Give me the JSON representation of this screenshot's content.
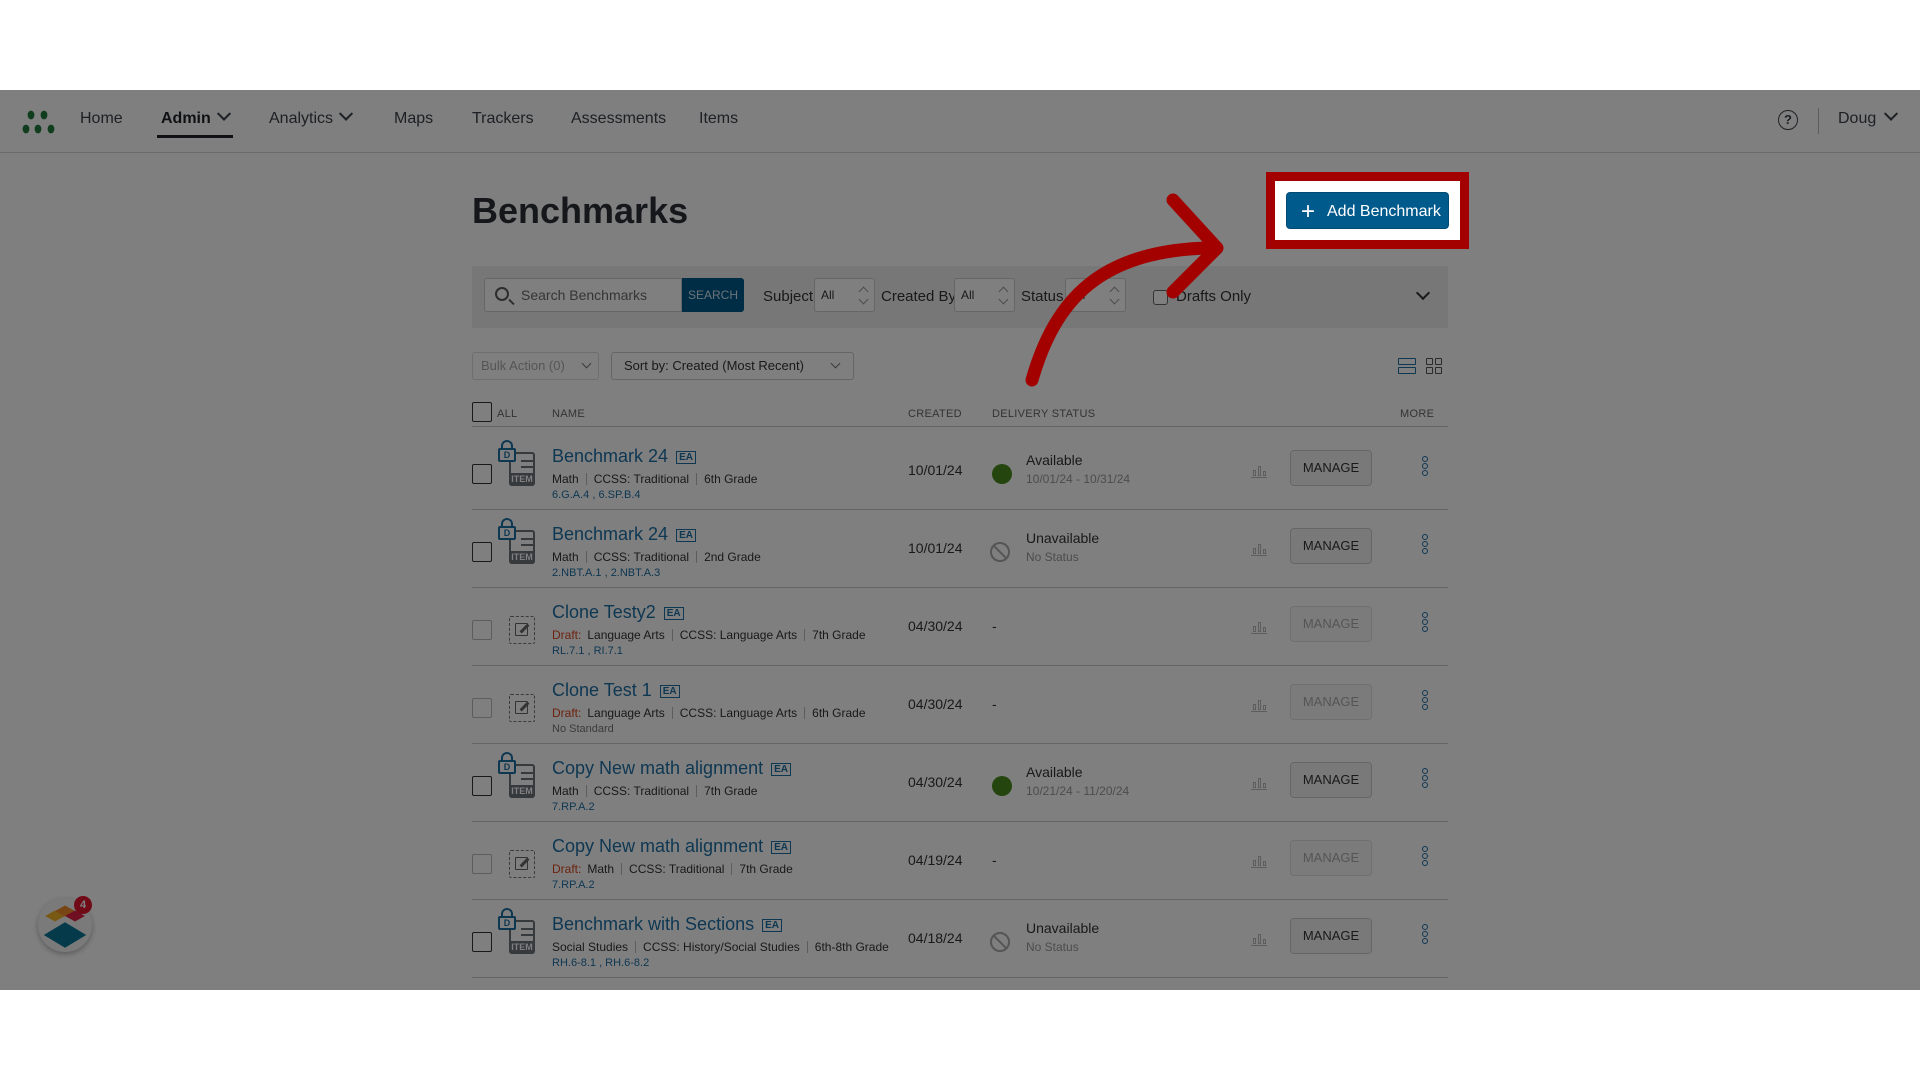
{
  "nav": {
    "items": [
      {
        "label": "Home",
        "active": false,
        "has_dropdown": false
      },
      {
        "label": "Admin",
        "active": true,
        "has_dropdown": true
      },
      {
        "label": "Analytics",
        "active": false,
        "has_dropdown": true
      },
      {
        "label": "Maps",
        "active": false,
        "has_dropdown": false
      },
      {
        "label": "Trackers",
        "active": false,
        "has_dropdown": false
      },
      {
        "label": "Assessments",
        "active": false,
        "has_dropdown": false
      },
      {
        "label": "Items",
        "active": false,
        "has_dropdown": false
      }
    ],
    "help_icon": "?",
    "user": "Doug"
  },
  "page": {
    "title": "Benchmarks",
    "add_button": "Add Benchmark",
    "add_icon": "+"
  },
  "filters": {
    "search_placeholder": "Search Benchmarks",
    "search_button": "SEARCH",
    "subject_label": "Subject",
    "subject_value": "All",
    "created_by_label": "Created By",
    "created_by_value": "All",
    "status_label": "Status",
    "status_value": "All",
    "drafts_only_label": "Drafts Only",
    "drafts_only_checked": false
  },
  "toolbar": {
    "bulk_action": "Bulk Action (0)",
    "sort_by": "Sort by: Created (Most Recent)"
  },
  "table": {
    "headers": {
      "all": "ALL",
      "name": "NAME",
      "created": "CREATED",
      "delivery_status": "DELIVERY STATUS",
      "more": "MORE"
    },
    "manage_label": "MANAGE",
    "ea_badge": "EA",
    "draft_label": "Draft:",
    "rows": [
      {
        "name": "Benchmark 24",
        "draft": false,
        "subject": "Math",
        "standard_set": "CCSS: Traditional",
        "grade": "6th Grade",
        "standards": "6.G.A.4 , 6.SP.B.4",
        "created": "10/01/24",
        "status": "Available",
        "status_detail": "10/01/24 - 10/31/24",
        "status_type": "available"
      },
      {
        "name": "Benchmark 24",
        "draft": false,
        "subject": "Math",
        "standard_set": "CCSS: Traditional",
        "grade": "2nd Grade",
        "standards": "2.NBT.A.1 , 2.NBT.A.3",
        "created": "10/01/24",
        "status": "Unavailable",
        "status_detail": "No Status",
        "status_type": "unavailable"
      },
      {
        "name": "Clone Testy2",
        "draft": true,
        "subject": "Language Arts",
        "standard_set": "CCSS: Language Arts",
        "grade": "7th Grade",
        "standards": "RL.7.1 , RI.7.1",
        "created": "04/30/24",
        "status": "-",
        "status_detail": "",
        "status_type": "none"
      },
      {
        "name": "Clone Test 1",
        "draft": true,
        "subject": "Language Arts",
        "standard_set": "CCSS: Language Arts",
        "grade": "6th Grade",
        "standards": "No Standard",
        "created": "04/30/24",
        "status": "-",
        "status_detail": "",
        "status_type": "none"
      },
      {
        "name": "Copy New math alignment",
        "draft": false,
        "subject": "Math",
        "standard_set": "CCSS: Traditional",
        "grade": "7th Grade",
        "standards": "7.RP.A.2",
        "created": "04/30/24",
        "status": "Available",
        "status_detail": "10/21/24 - 11/20/24",
        "status_type": "available"
      },
      {
        "name": "Copy New math alignment",
        "draft": true,
        "subject": "Math",
        "standard_set": "CCSS: Traditional",
        "grade": "7th Grade",
        "standards": "7.RP.A.2",
        "created": "04/19/24",
        "status": "-",
        "status_detail": "",
        "status_type": "none"
      },
      {
        "name": "Benchmark with Sections",
        "draft": false,
        "subject": "Social Studies",
        "standard_set": "CCSS: History/Social Studies",
        "grade": "6th-8th Grade",
        "standards": "RH.6-8.1 , RH.6-8.2",
        "created": "04/18/24",
        "status": "Unavailable",
        "status_detail": "No Status",
        "status_type": "unavailable"
      }
    ]
  },
  "widget": {
    "notification_count": "4"
  },
  "colors": {
    "brand_blue": "#005a8c",
    "link_blue": "#1d6fa5",
    "available_green": "#4a8b1e",
    "draft_orange": "#d9451d",
    "annotation_red": "#a30000",
    "logo_green": "#1e7a3a"
  }
}
